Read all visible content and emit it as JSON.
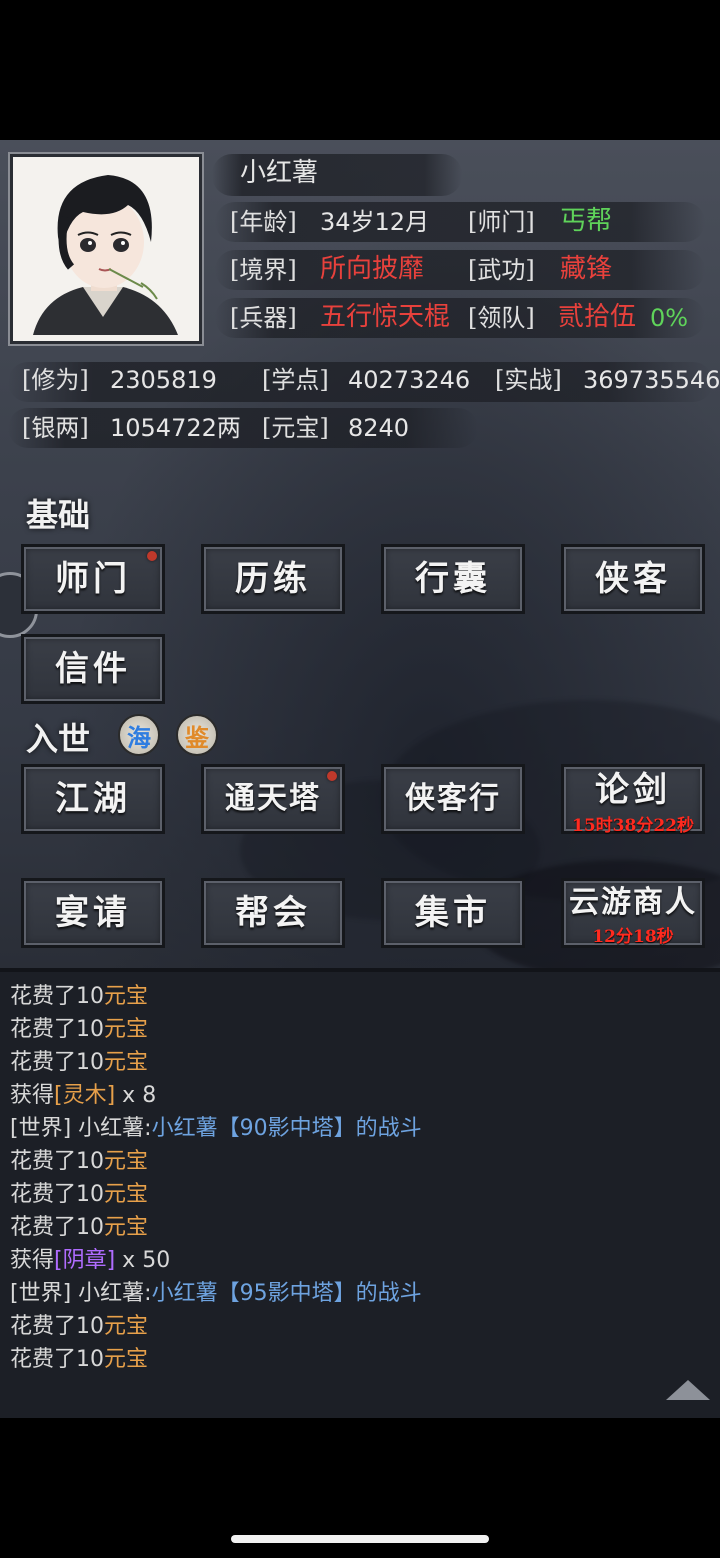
{
  "profile": {
    "name": "小红薯",
    "age_label": "[年龄]",
    "age_value": "34岁12月",
    "sect_label": "[师门]",
    "sect_value": "丐帮",
    "realm_label": "[境界]",
    "realm_value": "所向披靡",
    "skill_label": "[武功]",
    "skill_value": "藏锋",
    "weapon_label": "[兵器]",
    "weapon_value": "五行惊天棍",
    "team_label": "[领队]",
    "team_value": "贰拾伍",
    "team_percent": "0%"
  },
  "stats": {
    "cultivation_label": "[修为]",
    "cultivation_value": "2305819",
    "points_label": "[学点]",
    "points_value": "40273246",
    "combat_label": "[实战]",
    "combat_value": "369735546",
    "silver_label": "[银两]",
    "silver_value": "1054722两",
    "ingot_label": "[元宝]",
    "ingot_value": "8240"
  },
  "sections": {
    "basic_title": "基础",
    "world_title": "入世",
    "world_badges": [
      "海",
      "鉴"
    ]
  },
  "basic_buttons": [
    {
      "label": "师门",
      "dot": true
    },
    {
      "label": "历练",
      "dot": false
    },
    {
      "label": "行囊",
      "dot": false
    },
    {
      "label": "侠客",
      "dot": false
    },
    {
      "label": "信件",
      "dot": false
    }
  ],
  "world_buttons": [
    {
      "label": "江湖",
      "dot": false
    },
    {
      "label": "通天塔",
      "dot": true
    },
    {
      "label": "侠客行",
      "dot": false
    },
    {
      "label": "论剑",
      "timer": "15时38分22秒"
    },
    {
      "label": "宴请",
      "dot": false
    },
    {
      "label": "帮会",
      "dot": false
    },
    {
      "label": "集市",
      "dot": false
    },
    {
      "label": "云游商人",
      "timer": "12分18秒"
    }
  ],
  "log": {
    "spend_prefix": "花费了10",
    "spend_suffix": "元宝",
    "gain_prefix": "获得",
    "gain1_item": "[灵木]",
    "gain1_qty": " x 8",
    "world_tag": "[世界]",
    "world_user": "小红薯:",
    "world1_msg": "小红薯【90影中塔】的战斗",
    "gain2_item": "[阴章]",
    "gain2_qty": " x 50",
    "world2_msg": "小红薯【95影中塔】的战斗"
  },
  "colors": {
    "red_value": "#e8413c",
    "green_value": "#5fd35a",
    "timer_red": "#ff2a1f",
    "log_gold": "#e7a04a",
    "log_purple": "#b06cff",
    "log_link": "#6ea3e0"
  },
  "icons": {
    "scroll_up": "triangle-up-icon",
    "side_tab": "side-tab-handle"
  }
}
